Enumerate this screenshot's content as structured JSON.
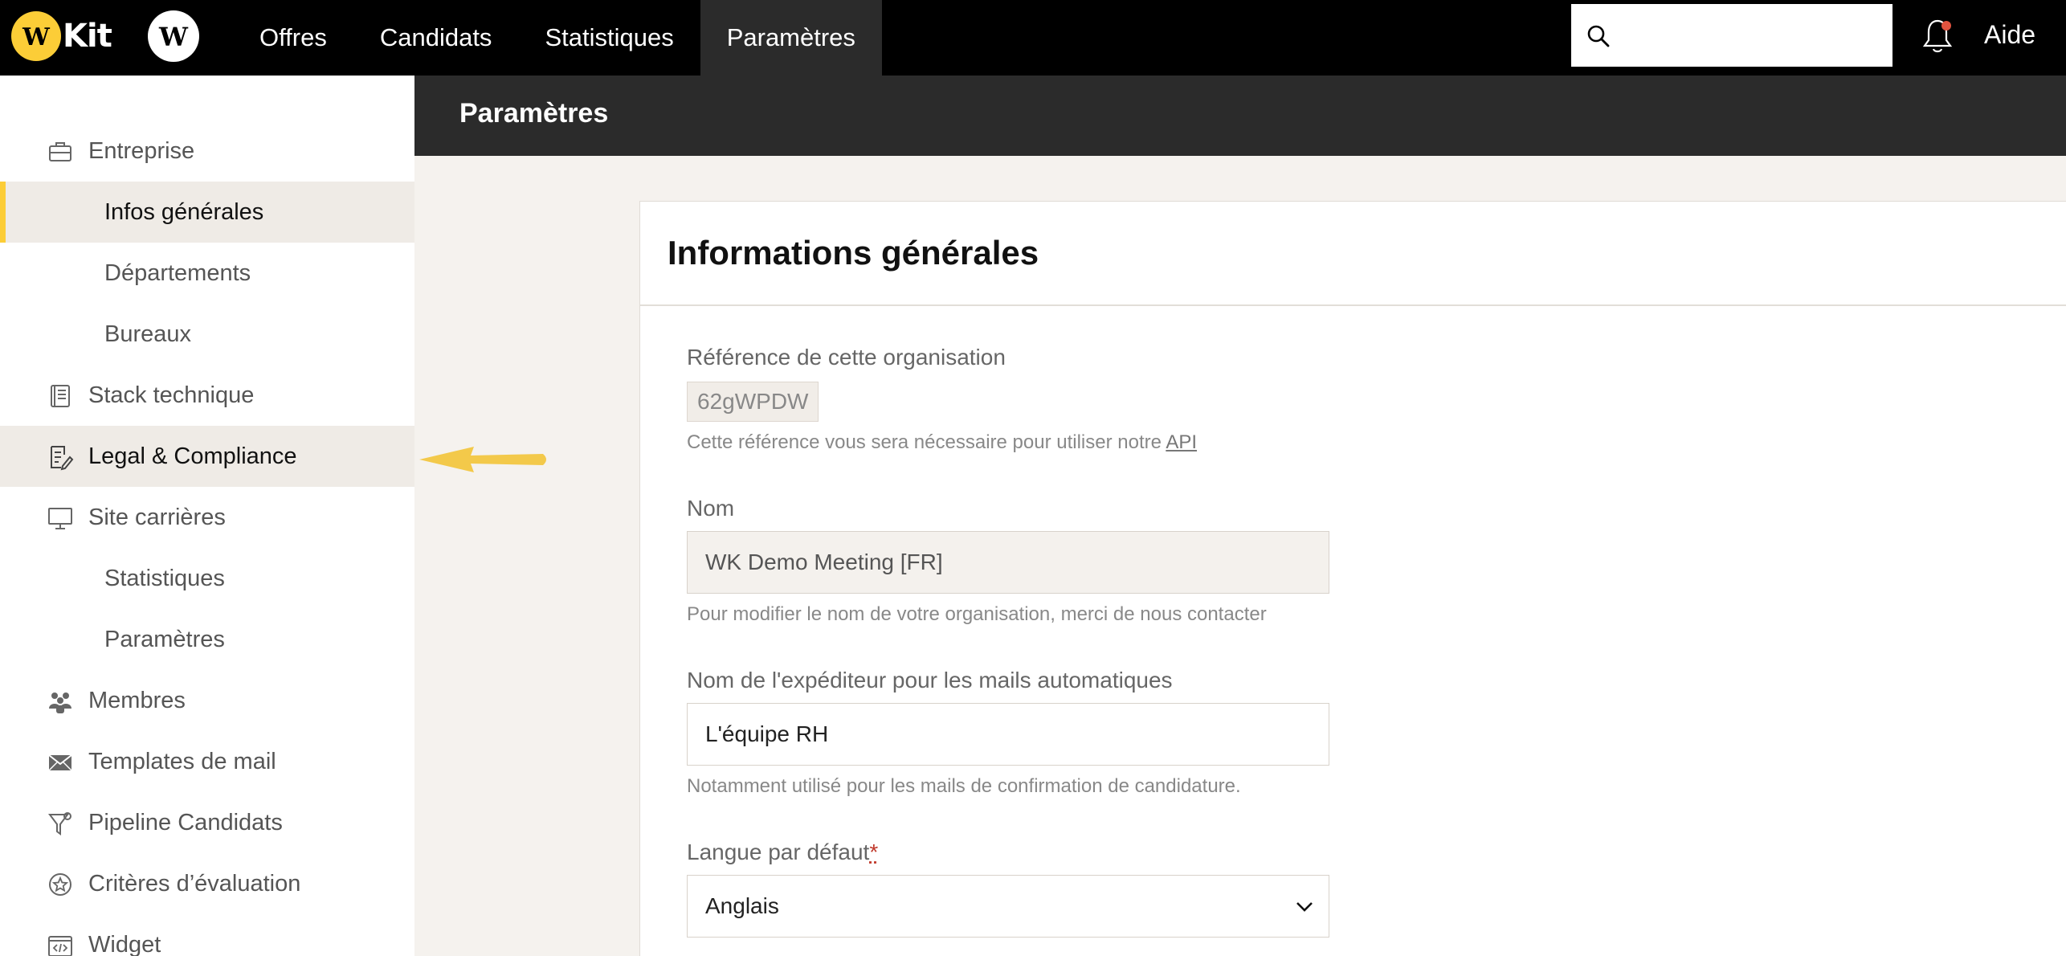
{
  "topbar": {
    "logo_text": "Kit",
    "nav": [
      "Offres",
      "Candidats",
      "Statistiques",
      "Paramètres"
    ],
    "active_nav": "Paramètres",
    "search_placeholder": "",
    "help_label": "Aide"
  },
  "sidebar": {
    "items": [
      {
        "label": "Entreprise",
        "icon": "briefcase-icon"
      },
      {
        "label": "Infos générales",
        "sub": true,
        "selected": true
      },
      {
        "label": "Départements",
        "sub": true
      },
      {
        "label": "Bureaux",
        "sub": true
      },
      {
        "label": "Stack technique",
        "icon": "book-icon"
      },
      {
        "label": "Legal & Compliance",
        "icon": "document-pen-icon",
        "hover": true
      },
      {
        "label": "Site carrières",
        "icon": "monitor-icon"
      },
      {
        "label": "Statistiques",
        "sub": true
      },
      {
        "label": "Paramètres",
        "sub": true
      },
      {
        "label": "Membres",
        "icon": "people-icon"
      },
      {
        "label": "Templates de mail",
        "icon": "envelope-icon"
      },
      {
        "label": "Pipeline Candidats",
        "icon": "funnel-icon"
      },
      {
        "label": "Critères d’évaluation",
        "icon": "star-badge-icon"
      },
      {
        "label": "Widget",
        "icon": "code-window-icon"
      }
    ]
  },
  "page": {
    "header_title": "Paramètres",
    "card_title": "Informations générales"
  },
  "form": {
    "reference": {
      "label": "Référence de cette organisation",
      "value": "62gWPDW",
      "help_prefix": "Cette référence vous sera nécessaire pour utiliser notre ",
      "help_link": "API"
    },
    "name": {
      "label": "Nom",
      "value": "WK Demo Meeting [FR]",
      "help": "Pour modifier le nom de votre organisation, merci de nous contacter"
    },
    "sender": {
      "label": "Nom de l'expéditeur pour les mails automatiques",
      "value": "L'équipe RH",
      "help": "Notamment utilisé pour les mails de confirmation de candidature."
    },
    "language": {
      "label": "Langue par défaut",
      "required_mark": "*",
      "value": "Anglais"
    }
  },
  "colors": {
    "accent": "#fccd37",
    "nav_bg": "#000000",
    "header_bg": "#2b2b2b",
    "page_bg": "#f5f2ee",
    "notification_dot": "#e0533f"
  }
}
